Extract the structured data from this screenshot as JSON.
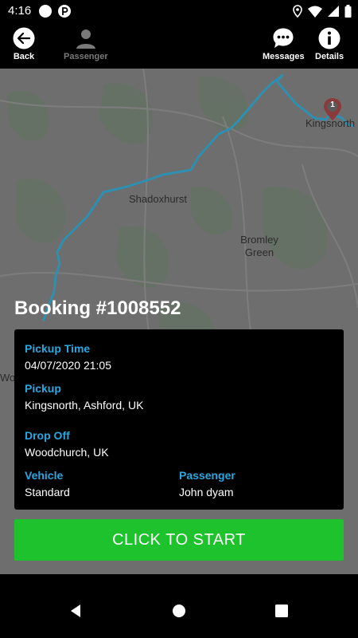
{
  "status": {
    "time": "4:16"
  },
  "toolbar": {
    "back_label": "Back",
    "passenger_label": "Passenger",
    "messages_label": "Messages",
    "details_label": "Details"
  },
  "map": {
    "places": [
      "Kingsnorth",
      "Shadoxhurst",
      "Bromley\nGreen",
      "Woo"
    ],
    "marker_number": "1"
  },
  "booking": {
    "title": "Booking #1008552",
    "pickup_time_label": "Pickup Time",
    "pickup_time": "04/07/2020 21:05",
    "pickup_label": "Pickup",
    "pickup": "Kingsnorth, Ashford, UK",
    "dropoff_label": "Drop Off",
    "dropoff": "Woodchurch, UK",
    "vehicle_label": "Vehicle",
    "vehicle": "Standard",
    "passenger_label": "Passenger",
    "passenger": "John dyam"
  },
  "action": {
    "start_label": "CLICK TO START"
  },
  "colors": {
    "accent": "#29a7e0",
    "start": "#1ec22c",
    "route": "#2f8fb0",
    "marker": "#8a3a3a"
  }
}
